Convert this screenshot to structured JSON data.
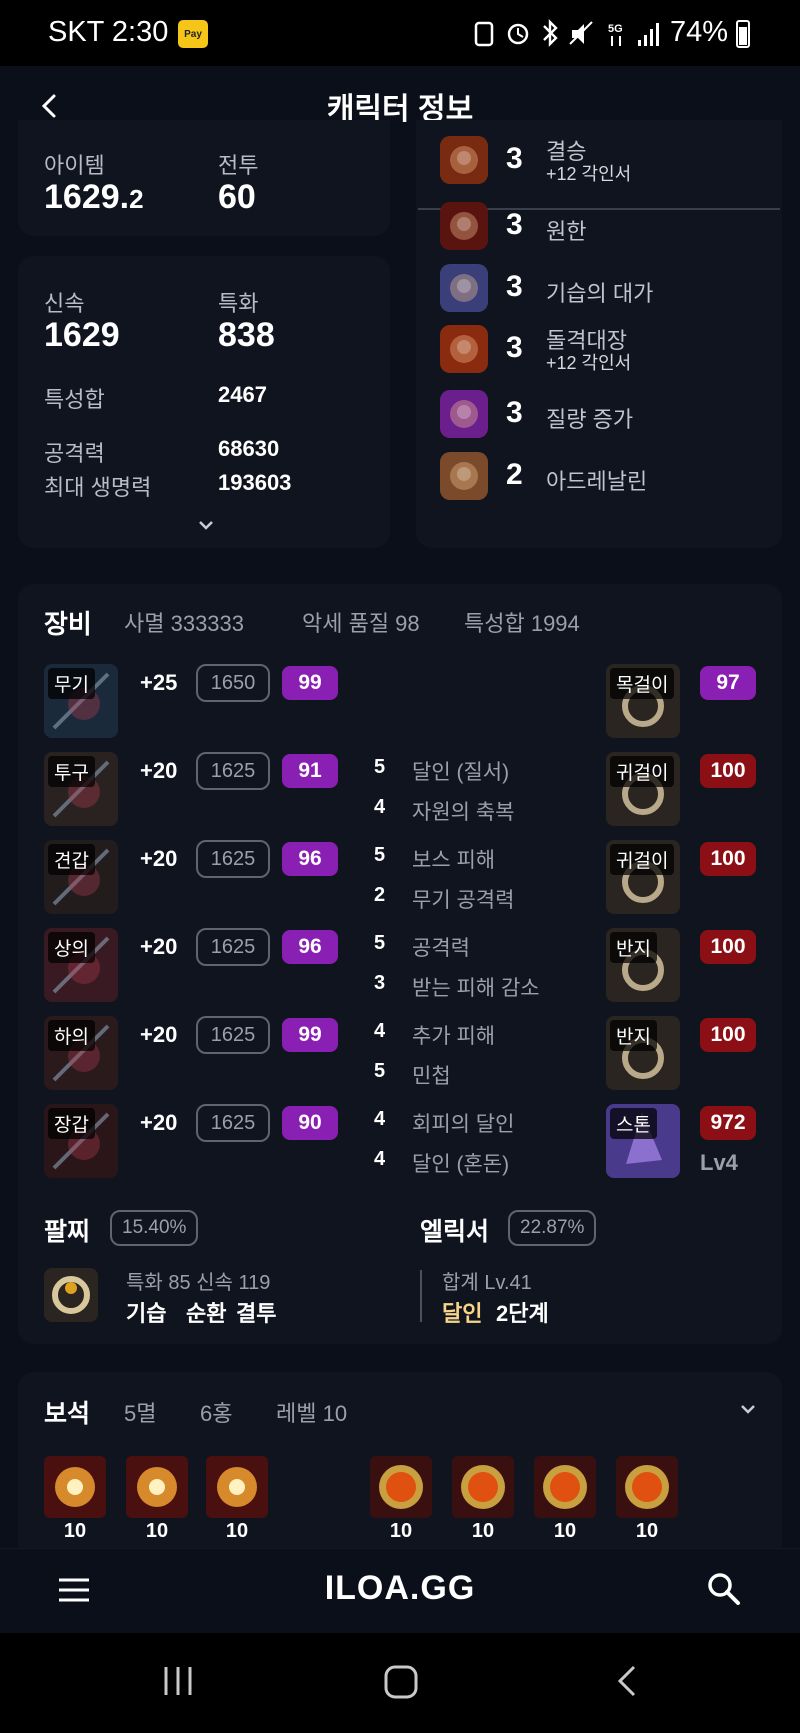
{
  "status": {
    "carrier_time": "SKT 2:30",
    "pay_badge": "Pay",
    "battery": "74%",
    "network": "5G"
  },
  "header": {
    "title": "캐릭터 정보"
  },
  "summary": {
    "item_label": "아이템",
    "item_value_main": "1629.",
    "item_value_frac": "2",
    "combat_label": "전투",
    "combat_value": "60"
  },
  "stats": {
    "swift_label": "신속",
    "swift_value": "1629",
    "spec_label": "특화",
    "spec_value": "838",
    "total_label": "특성합",
    "total_value": "2467",
    "atk_label": "공격력",
    "atk_value": "68630",
    "hp_label": "최대 생명력",
    "hp_value": "193603"
  },
  "engravings": [
    {
      "level": "3",
      "name": "결승",
      "sub": "+12 각인서",
      "color": "#7a2a10"
    },
    {
      "level": "3",
      "name": "원한",
      "sub": "",
      "color": "#5a1410"
    },
    {
      "level": "3",
      "name": "기습의 대가",
      "sub": "",
      "color": "#3a3f7a"
    },
    {
      "level": "3",
      "name": "돌격대장",
      "sub": "+12 각인서",
      "color": "#8a2a0e"
    },
    {
      "level": "3",
      "name": "질량 증가",
      "sub": "",
      "color": "#6b1f8c"
    },
    {
      "level": "2",
      "name": "아드레날린",
      "sub": "",
      "color": "#7a4a2a"
    }
  ],
  "equipment": {
    "title": "장비",
    "summary1": "사멸 333333",
    "summary2": "악세 품질 98",
    "summary3": "특성합 1994",
    "armor": [
      {
        "tag": "무기",
        "plus": "+25",
        "ilvl": "1650",
        "quality": "99",
        "effects": []
      },
      {
        "tag": "투구",
        "plus": "+20",
        "ilvl": "1625",
        "quality": "91",
        "effects": [
          {
            "n": "5",
            "t": "달인 (질서)"
          },
          {
            "n": "4",
            "t": "자원의 축복"
          }
        ]
      },
      {
        "tag": "견갑",
        "plus": "+20",
        "ilvl": "1625",
        "quality": "96",
        "effects": [
          {
            "n": "5",
            "t": "보스 피해"
          },
          {
            "n": "2",
            "t": "무기 공격력"
          }
        ]
      },
      {
        "tag": "상의",
        "plus": "+20",
        "ilvl": "1625",
        "quality": "96",
        "effects": [
          {
            "n": "5",
            "t": "공격력"
          },
          {
            "n": "3",
            "t": "받는 피해 감소"
          }
        ]
      },
      {
        "tag": "하의",
        "plus": "+20",
        "ilvl": "1625",
        "quality": "99",
        "effects": [
          {
            "n": "4",
            "t": "추가 피해"
          },
          {
            "n": "5",
            "t": "민첩"
          }
        ]
      },
      {
        "tag": "장갑",
        "plus": "+20",
        "ilvl": "1625",
        "quality": "90",
        "effects": [
          {
            "n": "4",
            "t": "회피의 달인"
          },
          {
            "n": "4",
            "t": "달인 (혼돈)"
          }
        ]
      }
    ],
    "accessories": [
      {
        "tag": "목걸이",
        "quality": "97",
        "tier": "purple"
      },
      {
        "tag": "귀걸이",
        "quality": "100",
        "tier": "red"
      },
      {
        "tag": "귀걸이",
        "quality": "100",
        "tier": "red"
      },
      {
        "tag": "반지",
        "quality": "100",
        "tier": "red"
      },
      {
        "tag": "반지",
        "quality": "100",
        "tier": "red"
      },
      {
        "tag": "스톤",
        "quality": "972",
        "tier": "red",
        "extra": "Lv4"
      }
    ]
  },
  "bracelet": {
    "title": "팔찌",
    "percent": "15.40%",
    "stats": "특화 85 신속 119",
    "e1": "기습",
    "e2": "순환",
    "e3": "결투"
  },
  "elixir": {
    "title": "엘릭서",
    "percent": "22.87%",
    "total": "합계 Lv.41",
    "name": "달인",
    "stage": "2단계"
  },
  "gems": {
    "title": "보석",
    "t1": "5멸",
    "t2": "6홍",
    "t3": "레벨 10",
    "left_levels": [
      "10",
      "10",
      "10"
    ],
    "right_levels": [
      "10",
      "10",
      "10",
      "10"
    ]
  },
  "nav": {
    "logo": "ILOA.GG"
  }
}
